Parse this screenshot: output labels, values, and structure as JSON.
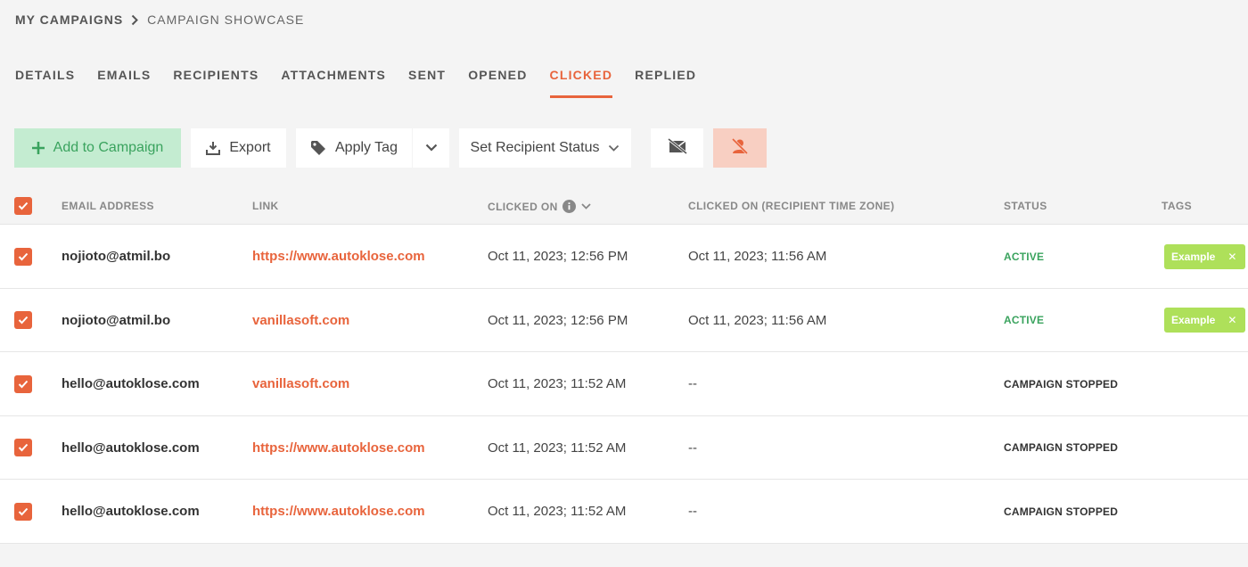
{
  "breadcrumb": {
    "root": "MY CAMPAIGNS",
    "current": "CAMPAIGN SHOWCASE"
  },
  "tabs": [
    {
      "label": "DETAILS",
      "active": false
    },
    {
      "label": "EMAILS",
      "active": false
    },
    {
      "label": "RECIPIENTS",
      "active": false
    },
    {
      "label": "ATTACHMENTS",
      "active": false
    },
    {
      "label": "SENT",
      "active": false
    },
    {
      "label": "OPENED",
      "active": false
    },
    {
      "label": "CLICKED",
      "active": true
    },
    {
      "label": "REPLIED",
      "active": false
    }
  ],
  "toolbar": {
    "add_label": "Add to Campaign",
    "export_label": "Export",
    "apply_tag_label": "Apply Tag",
    "set_status_label": "Set Recipient Status"
  },
  "table": {
    "headers": {
      "email": "EMAIL ADDRESS",
      "link": "LINK",
      "clicked_on": "CLICKED ON",
      "clicked_on_tz": "CLICKED ON (RECIPIENT TIME ZONE)",
      "status": "STATUS",
      "tags": "TAGS"
    },
    "rows": [
      {
        "email": "nojioto@atmil.bo",
        "link": "https://www.autoklose.com",
        "clicked_on": "Oct 11, 2023; 12:56 PM",
        "clicked_on_tz": "Oct 11, 2023; 11:56 AM",
        "status": "ACTIVE",
        "tag": "Example"
      },
      {
        "email": "nojioto@atmil.bo",
        "link": "vanillasoft.com",
        "clicked_on": "Oct 11, 2023; 12:56 PM",
        "clicked_on_tz": "Oct 11, 2023; 11:56 AM",
        "status": "ACTIVE",
        "tag": "Example"
      },
      {
        "email": "hello@autoklose.com",
        "link": "vanillasoft.com",
        "clicked_on": "Oct 11, 2023; 11:52 AM",
        "clicked_on_tz": "--",
        "status": "CAMPAIGN STOPPED",
        "tag": ""
      },
      {
        "email": "hello@autoklose.com",
        "link": "https://www.autoklose.com",
        "clicked_on": "Oct 11, 2023; 11:52 AM",
        "clicked_on_tz": "--",
        "status": "CAMPAIGN STOPPED",
        "tag": ""
      },
      {
        "email": "hello@autoklose.com",
        "link": "https://www.autoklose.com",
        "clicked_on": "Oct 11, 2023; 11:52 AM",
        "clicked_on_tz": "--",
        "status": "CAMPAIGN STOPPED",
        "tag": ""
      }
    ]
  },
  "colors": {
    "accent": "#e8643c",
    "active_status": "#3aa35e",
    "stopped_status": "#333333",
    "tag_bg": "#aee05a",
    "add_button_bg": "#c4ecd1"
  },
  "icons": {
    "breadcrumb_separator": "chevron-right-icon",
    "add": "plus-icon",
    "export": "download-icon",
    "apply_tag": "tag-icon",
    "dropdown": "chevron-down-icon",
    "mail_off": "mail-off-icon",
    "user_off": "user-off-icon",
    "info": "info-icon",
    "sort": "chevron-down-icon",
    "tag_remove": "close-icon",
    "checkbox": "checkmark-icon"
  }
}
